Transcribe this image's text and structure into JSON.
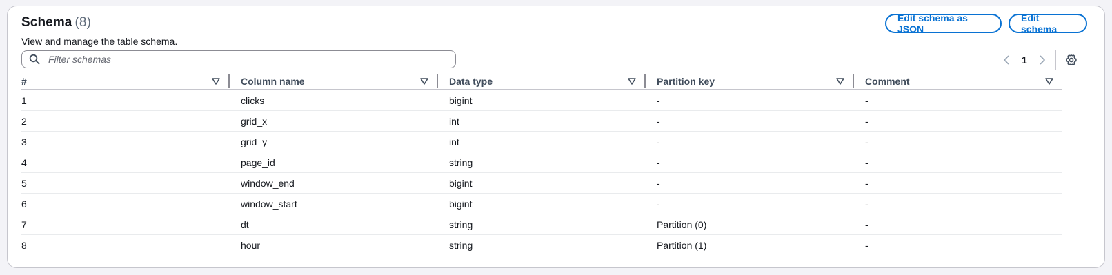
{
  "header": {
    "title": "Schema",
    "count": "(8)",
    "description": "View and manage the table schema.",
    "edit_json_label": "Edit schema as JSON",
    "edit_label": "Edit schema"
  },
  "filter": {
    "placeholder": "Filter schemas",
    "value": ""
  },
  "pagination": {
    "current_page": "1"
  },
  "table": {
    "columns": [
      "#",
      "Column name",
      "Data type",
      "Partition key",
      "Comment"
    ],
    "rows": [
      [
        "1",
        "clicks",
        "bigint",
        "-",
        "-"
      ],
      [
        "2",
        "grid_x",
        "int",
        "-",
        "-"
      ],
      [
        "3",
        "grid_y",
        "int",
        "-",
        "-"
      ],
      [
        "4",
        "page_id",
        "string",
        "-",
        "-"
      ],
      [
        "5",
        "window_end",
        "bigint",
        "-",
        "-"
      ],
      [
        "6",
        "window_start",
        "bigint",
        "-",
        "-"
      ],
      [
        "7",
        "dt",
        "string",
        "Partition (0)",
        "-"
      ],
      [
        "8",
        "hour",
        "string",
        "Partition (1)",
        "-"
      ]
    ]
  },
  "icons": {
    "search": "search-icon",
    "sort": "sort-down-icon",
    "prev": "chevron-left-icon",
    "next": "chevron-right-icon",
    "settings": "gear-icon"
  },
  "colors": {
    "accent": "#0972d3",
    "border": "#c6c6cd",
    "text": "#16191f",
    "muted": "#5f6b7a"
  }
}
